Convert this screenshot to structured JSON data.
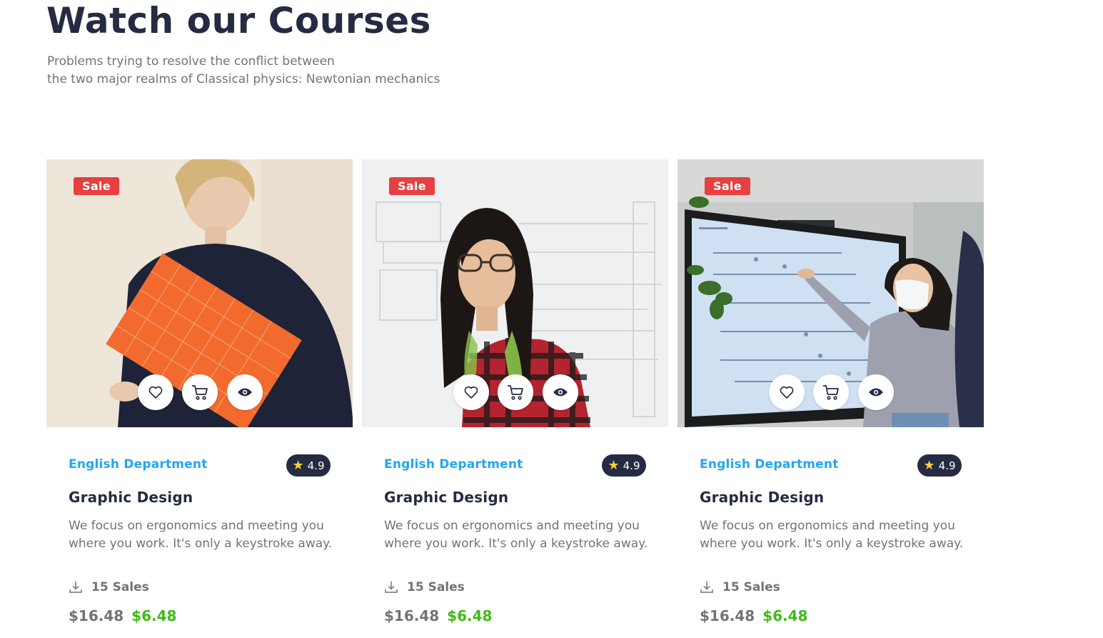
{
  "header": {
    "title": "Watch our Courses",
    "subtitle_line1": "Problems trying to resolve the conflict between",
    "subtitle_line2": "the two major realms of Classical physics: Newtonian mechanics"
  },
  "colors": {
    "sale": "#E74040",
    "department": "#23A6F0",
    "rating_bg": "#252B42",
    "star": "#FFCE31",
    "new_price": "#40BB15",
    "muted": "#737373"
  },
  "courses": [
    {
      "badge": "Sale",
      "department": "English Department",
      "rating": "4.9",
      "title": "Graphic Design",
      "description": "We focus on ergonomics and meeting you where you work. It's only a keystroke away.",
      "sales": "15 Sales",
      "old_price": "$16.48",
      "new_price": "$6.48",
      "actions": [
        "heart-icon",
        "cart-icon",
        "eye-icon"
      ]
    },
    {
      "badge": "Sale",
      "department": "English Department",
      "rating": "4.9",
      "title": "Graphic Design",
      "description": "We focus on ergonomics and meeting you where you work. It's only a keystroke away.",
      "sales": "15 Sales",
      "old_price": "$16.48",
      "new_price": "$6.48",
      "actions": [
        "heart-icon",
        "cart-icon",
        "eye-icon"
      ]
    },
    {
      "badge": "Sale",
      "department": "English Department",
      "rating": "4.9",
      "title": "Graphic Design",
      "description": "We focus on ergonomics and meeting you where you work. It's only a keystroke away.",
      "sales": "15 Sales",
      "old_price": "$16.48",
      "new_price": "$6.48",
      "actions": [
        "heart-icon",
        "cart-icon",
        "eye-icon"
      ]
    }
  ]
}
